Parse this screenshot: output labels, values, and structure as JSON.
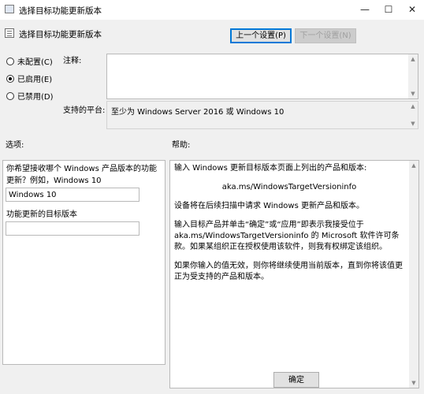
{
  "window": {
    "title": "选择目标功能更新版本",
    "minimize_glyph": "—",
    "maximize_glyph": "☐",
    "close_glyph": "✕"
  },
  "header": {
    "policy_title": "选择目标功能更新版本",
    "prev_button": "上一个设置(P)",
    "next_button": "下一个设置(N)"
  },
  "state_options": [
    {
      "label": "未配置(C)",
      "selected": false
    },
    {
      "label": "已启用(E)",
      "selected": true
    },
    {
      "label": "已禁用(D)",
      "selected": false
    }
  ],
  "comment": {
    "label": "注释:",
    "value": ""
  },
  "platform": {
    "label": "支持的平台:",
    "value": "至少为 Windows Server 2016 或 Windows 10"
  },
  "options": {
    "label": "选项:",
    "question": "你希望接收哪个 Windows 产品版本的功能更新？例如，Windows 10",
    "product_value": "Windows 10",
    "target_label": "功能更新的目标版本",
    "target_value": ""
  },
  "help": {
    "label": "帮助:",
    "paragraphs": [
      "输入 Windows 更新目标版本页面上列出的产品和版本:",
      "aka.ms/WindowsTargetVersioninfo",
      "设备将在后续扫描中请求 Windows 更新产品和版本。",
      "输入目标产品并单击“确定”或“应用”即表示我接受位于 aka.ms/WindowsTargetVersioninfo 的 Microsoft 软件许可条款。如果某组织正在授权使用该软件，则我有权绑定该组织。",
      "如果你输入的值无效，则你将继续使用当前版本，直到你将该值更正为受支持的产品和版本。"
    ]
  },
  "footer": {
    "ok_button": "确定"
  },
  "colors": {
    "focus": "#0078d7",
    "background": "#f0f0f0"
  }
}
